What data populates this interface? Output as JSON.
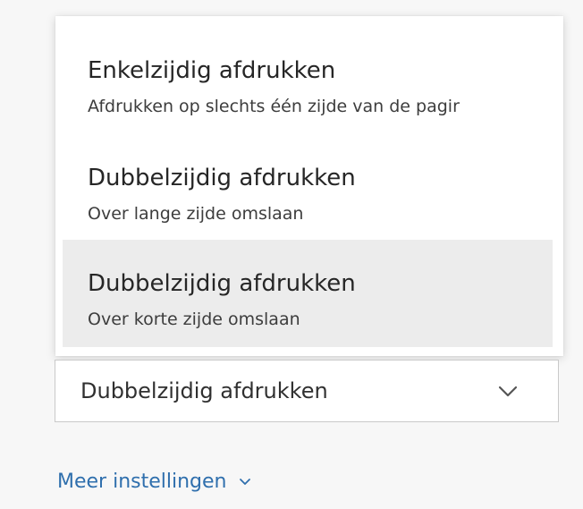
{
  "dropdown": {
    "options": [
      {
        "title": "Enkelzijdig afdrukken",
        "subtitle": "Afdrukken op slechts één zijde van de pagir"
      },
      {
        "title": "Dubbelzijdig afdrukken",
        "subtitle": "Over lange zijde omslaan"
      },
      {
        "title": "Dubbelzijdig afdrukken",
        "subtitle": "Over korte zijde omslaan"
      }
    ],
    "selected_value": "Dubbelzijdig afdrukken",
    "chevron_icon": "chevron-down-icon"
  },
  "more_settings": {
    "label": "Meer instellingen",
    "icon": "chevron-down-icon"
  },
  "colors": {
    "accent": "#2f6fad",
    "highlight": "#ececec"
  }
}
